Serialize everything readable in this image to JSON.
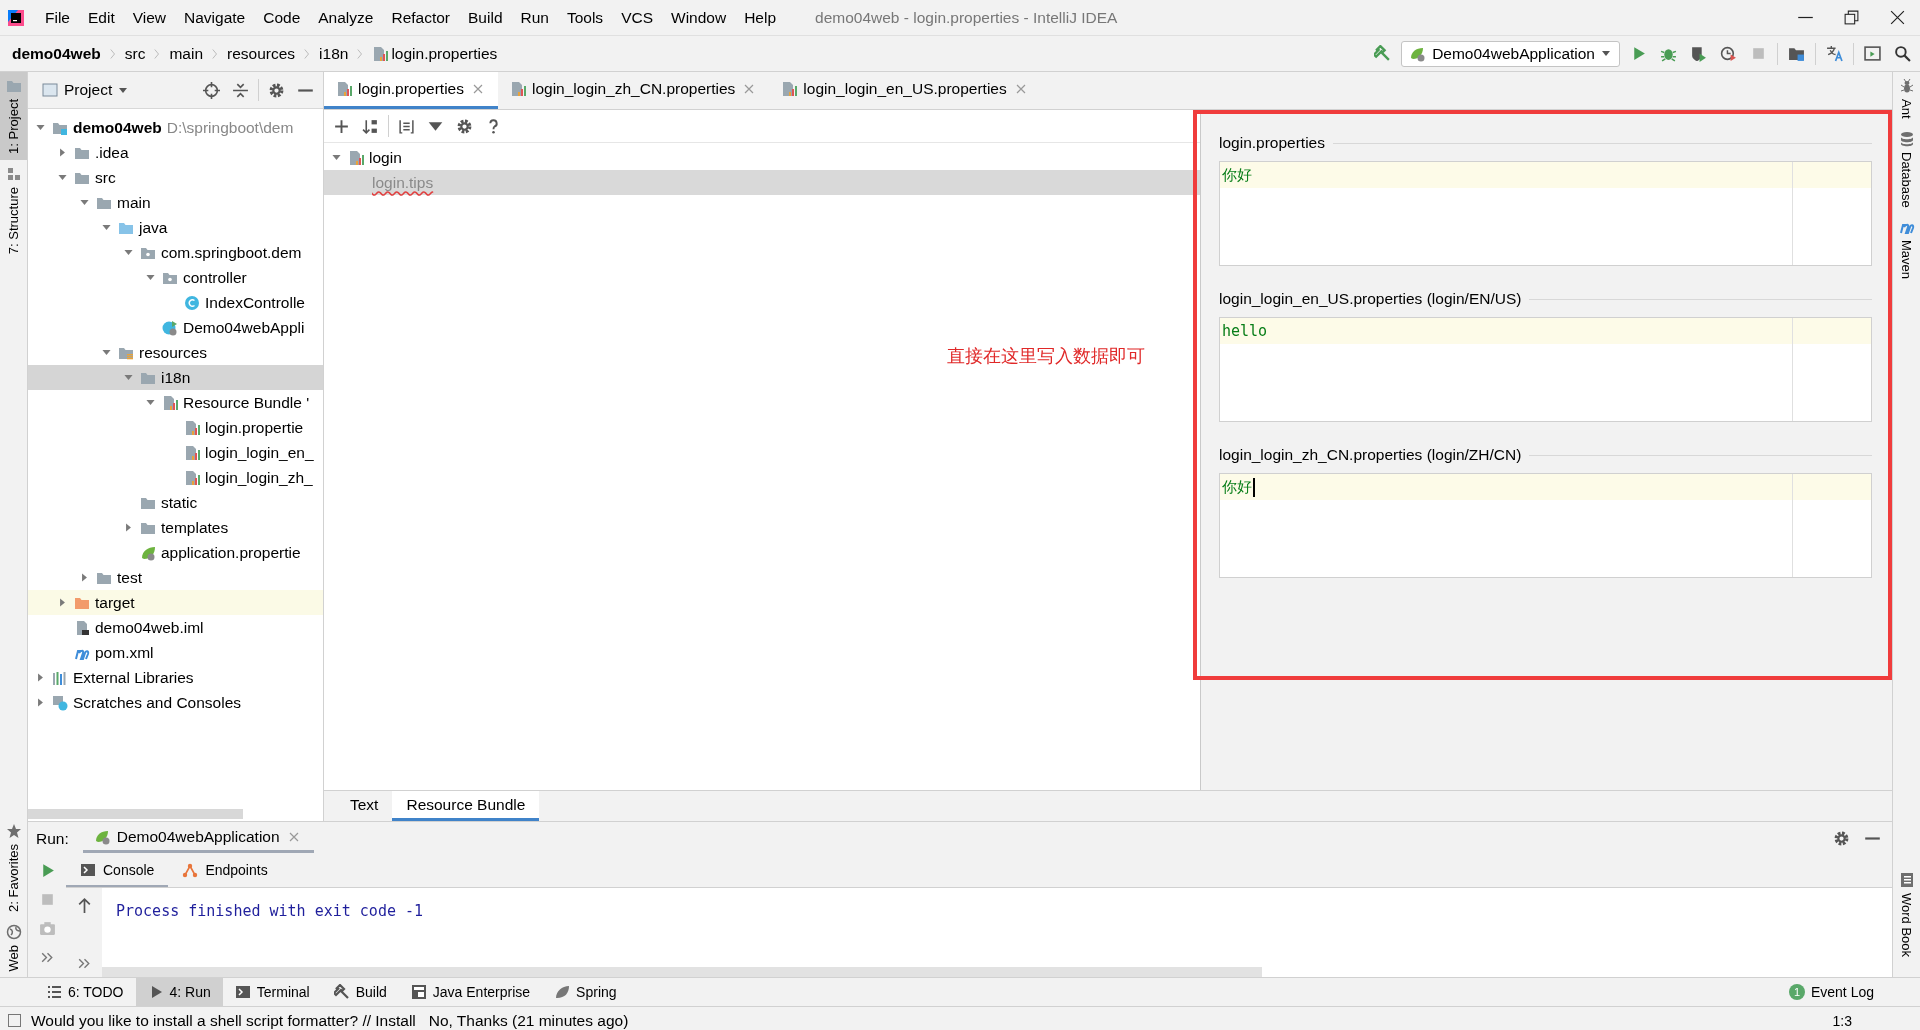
{
  "window": {
    "title": "demo04web - login.properties - IntelliJ IDEA"
  },
  "menu": [
    "File",
    "Edit",
    "View",
    "Navigate",
    "Code",
    "Analyze",
    "Refactor",
    "Build",
    "Run",
    "Tools",
    "VCS",
    "Window",
    "Help"
  ],
  "breadcrumbs": [
    {
      "label": "demo04web",
      "kind": "module"
    },
    {
      "label": "src",
      "kind": "plain"
    },
    {
      "label": "main",
      "kind": "plain"
    },
    {
      "label": "resources",
      "kind": "plain"
    },
    {
      "label": "i18n",
      "kind": "plain"
    },
    {
      "label": "login.properties",
      "kind": "bundle-file"
    }
  ],
  "run_config": {
    "label": "Demo04webApplication"
  },
  "left_strip": [
    {
      "label": "1: Project",
      "kind": "folder",
      "selected": true
    },
    {
      "label": "7: Structure",
      "kind": "structure",
      "selected": false
    }
  ],
  "left_strip_bottom": [
    {
      "label": "2: Favorites",
      "kind": "star"
    },
    {
      "label": "Web",
      "kind": "globe"
    }
  ],
  "right_strip": [
    {
      "label": "Ant",
      "kind": "ant"
    },
    {
      "label": "Database",
      "kind": "database"
    },
    {
      "label": "Maven",
      "kind": "maven"
    }
  ],
  "right_strip_bottom": [
    {
      "label": "Word Book",
      "kind": "book"
    }
  ],
  "project_panel": {
    "title": "Project"
  },
  "project_tree": [
    {
      "label": "demo04web",
      "note": "D:\\springboot\\dem",
      "kind": "module",
      "expanded": true,
      "selected": false,
      "children": [
        {
          "label": ".idea",
          "kind": "folder",
          "expanded": false,
          "selected": false
        },
        {
          "label": "src",
          "kind": "folder",
          "expanded": true,
          "selected": false,
          "children": [
            {
              "label": "main",
              "kind": "folder",
              "expanded": true,
              "selected": false,
              "children": [
                {
                  "label": "java",
                  "kind": "source-folder",
                  "expanded": true,
                  "selected": false,
                  "children": [
                    {
                      "label": "com.springboot.dem",
                      "kind": "package",
                      "expanded": true,
                      "selected": false,
                      "children": [
                        {
                          "label": "controller",
                          "kind": "package",
                          "expanded": true,
                          "selected": false,
                          "children": [
                            {
                              "label": "IndexControlle",
                              "kind": "class",
                              "selected": false
                            }
                          ]
                        },
                        {
                          "label": "Demo04webAppli",
                          "kind": "spring-class",
                          "selected": false
                        }
                      ]
                    }
                  ]
                },
                {
                  "label": "resources",
                  "kind": "resources",
                  "expanded": true,
                  "selected": false,
                  "children": [
                    {
                      "label": "i18n",
                      "kind": "folder",
                      "expanded": true,
                      "selected": true,
                      "children": [
                        {
                          "label": "Resource Bundle '",
                          "kind": "bundle",
                          "expanded": true,
                          "selected": false,
                          "children": [
                            {
                              "label": "login.propertie",
                              "kind": "bundle-file",
                              "selected": false
                            },
                            {
                              "label": "login_login_en_",
                              "kind": "bundle-file",
                              "selected": false
                            },
                            {
                              "label": "login_login_zh_",
                              "kind": "bundle-file",
                              "selected": false
                            }
                          ]
                        }
                      ]
                    },
                    {
                      "label": "static",
                      "kind": "folder",
                      "selected": false
                    },
                    {
                      "label": "templates",
                      "kind": "folder",
                      "expanded": false,
                      "selected": false
                    },
                    {
                      "label": "application.propertie",
                      "kind": "spring-props",
                      "selected": false
                    }
                  ]
                }
              ]
            },
            {
              "label": "test",
              "kind": "folder",
              "expanded": false,
              "selected": false
            }
          ]
        },
        {
          "label": "target",
          "kind": "excluded-folder",
          "expanded": false,
          "selected": false
        },
        {
          "label": "demo04web.iml",
          "kind": "iml",
          "selected": false
        },
        {
          "label": "pom.xml",
          "kind": "maven",
          "selected": false
        }
      ]
    },
    {
      "label": "External Libraries",
      "kind": "libraries",
      "expanded": false,
      "selected": false
    },
    {
      "label": "Scratches and Consoles",
      "kind": "scratches",
      "expanded": false,
      "selected": false
    }
  ],
  "editor_tabs": [
    {
      "label": "login.properties",
      "selected": true
    },
    {
      "label": "login_login_zh_CN.properties",
      "selected": false
    },
    {
      "label": "login_login_en_US.properties",
      "selected": false
    }
  ],
  "bundle_tree": [
    {
      "label": "login",
      "expanded": true,
      "selected": false,
      "children": [
        {
          "label": "login.tips",
          "selected": true
        }
      ]
    }
  ],
  "annotation": {
    "text": "直接在这里写入数据即可"
  },
  "bundle_values": [
    {
      "title": "login.properties",
      "value": "你好",
      "caret": false
    },
    {
      "title": "login_login_en_US.properties (login/EN/US)",
      "value": "hello",
      "caret": false
    },
    {
      "title": "login_login_zh_CN.properties (login/ZH/CN)",
      "value": "你好",
      "caret": true
    }
  ],
  "editor_view_tabs": [
    {
      "label": "Text",
      "selected": false
    },
    {
      "label": "Resource Bundle",
      "selected": true
    }
  ],
  "run_panel": {
    "label": "Run:",
    "config_tab": "Demo04webApplication",
    "tabs": [
      {
        "label": "Console",
        "kind": "console",
        "selected": true
      },
      {
        "label": "Endpoints",
        "kind": "endpoints",
        "selected": false
      }
    ],
    "console_lines": [
      "Process finished with exit code -1"
    ]
  },
  "tool_tabs": [
    {
      "label": "6: TODO",
      "kind": "todo",
      "selected": false
    },
    {
      "label": "4: Run",
      "kind": "run",
      "selected": true
    },
    {
      "label": "Terminal",
      "kind": "terminal",
      "selected": false
    },
    {
      "label": "Build",
      "kind": "build",
      "selected": false
    },
    {
      "label": "Java Enterprise",
      "kind": "javaee",
      "selected": false
    },
    {
      "label": "Spring",
      "kind": "spring",
      "selected": false
    }
  ],
  "event_log": {
    "label": "Event Log",
    "count": "1"
  },
  "status_bar": {
    "message": "Would you like to install a shell script formatter? // Install   No, Thanks (21 minutes ago)",
    "position": "1:3"
  }
}
